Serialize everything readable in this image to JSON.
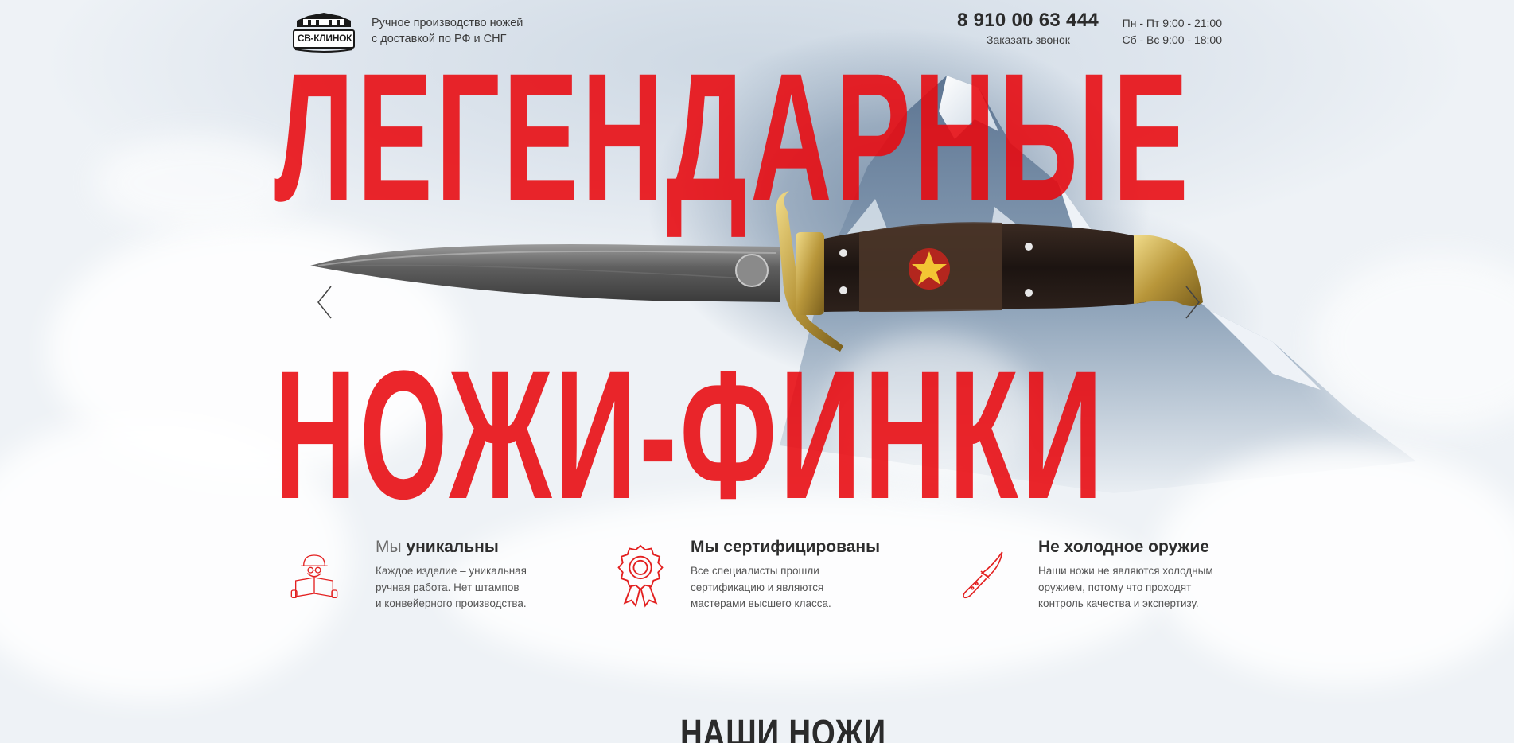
{
  "header": {
    "logo_text": "СВ-КЛИНОК",
    "tagline_line1": "Ручное производство ножей",
    "tagline_line2": "с доставкой по РФ и СНГ",
    "phone": "8 910 00 63 444",
    "callback_label": "Заказать звонок",
    "hours_weekdays": "Пн - Пт 9:00 - 21:00",
    "hours_weekend": "Сб - Вс 9:00 - 18:00"
  },
  "hero": {
    "headline_line1": "ЛЕГЕНДАРНЫЕ",
    "headline_line2": "НОЖИ-ФИНКИ",
    "accent_color": "#e8080e"
  },
  "features": [
    {
      "icon": "worker-reading-icon",
      "title_muted": "Мы",
      "title_rest": " уникальны",
      "desc_line1": "Каждое изделие – уникальная",
      "desc_line2": "ручная работа. Нет штампов",
      "desc_line3": "и конвейерного производства."
    },
    {
      "icon": "award-rosette-icon",
      "title": "Мы сертифицированы",
      "desc_line1": "Все специалисты прошли",
      "desc_line2": "сертификацию и являются",
      "desc_line3": "мастерами высшего класса."
    },
    {
      "icon": "knife-icon",
      "title": "Не холодное оружие",
      "desc_line1": "Наши ножи не являются холодным",
      "desc_line2": "оружием, потому что проходят",
      "desc_line3": "контроль качества и экспертизу."
    }
  ],
  "section": {
    "title": "НАШИ НОЖИ"
  }
}
